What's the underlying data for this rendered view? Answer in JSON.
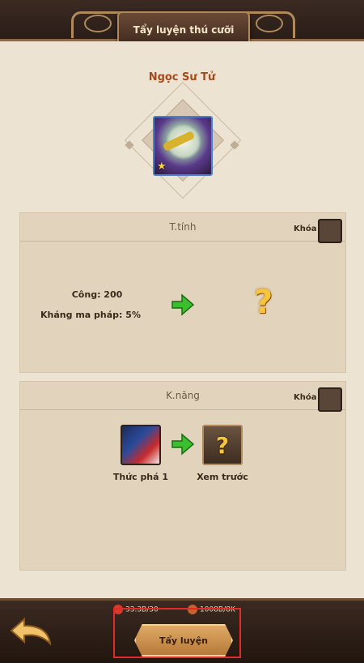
{
  "header": {
    "title": "Tẩy luyện thú cưỡi"
  },
  "pet": {
    "name": "Ngọc Sư Tử",
    "icon": "lion-mount-icon"
  },
  "attributes_panel": {
    "title": "T.tính",
    "lock_label": "Khóa",
    "stats": [
      "Công: 200",
      "Kháng ma pháp: 5%"
    ],
    "result_icon": "question-mark-icon",
    "result_text": "?"
  },
  "skills_panel": {
    "title": "K.năng",
    "lock_label": "Khóa",
    "current_skill": "Thức phá 1",
    "preview_skill": "Xem trước",
    "preview_icon_text": "?"
  },
  "footer": {
    "resource_1": "33.3B/30",
    "resource_2": "1008B/8K",
    "action_button": "Tẩy luyện"
  },
  "colors": {
    "accent": "#a64a1a",
    "highlight": "#e12a2a",
    "arrow": "#3cbf2f"
  }
}
